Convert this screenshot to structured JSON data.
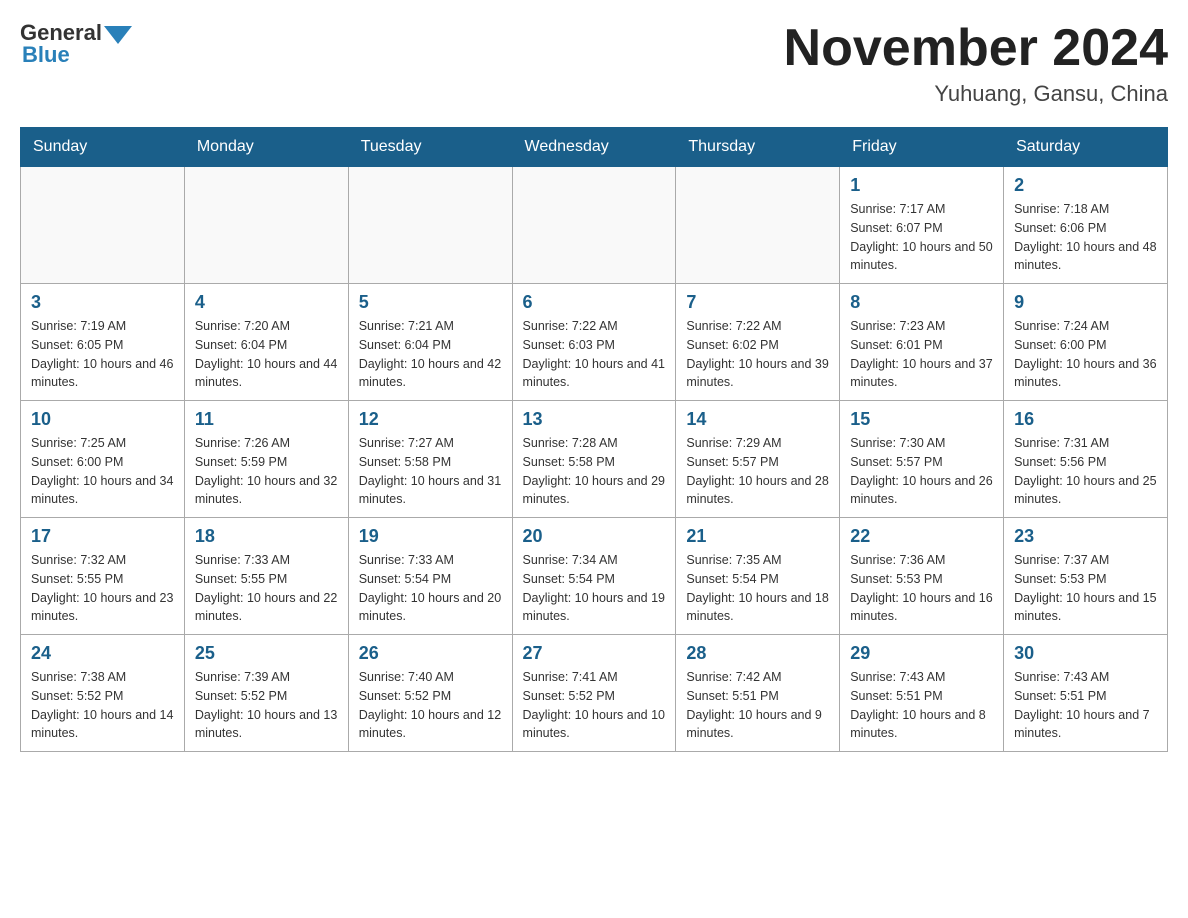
{
  "header": {
    "logo_general": "General",
    "logo_blue": "Blue",
    "month_title": "November 2024",
    "location": "Yuhuang, Gansu, China"
  },
  "weekdays": [
    "Sunday",
    "Monday",
    "Tuesday",
    "Wednesday",
    "Thursday",
    "Friday",
    "Saturday"
  ],
  "weeks": [
    [
      {
        "day": "",
        "info": ""
      },
      {
        "day": "",
        "info": ""
      },
      {
        "day": "",
        "info": ""
      },
      {
        "day": "",
        "info": ""
      },
      {
        "day": "",
        "info": ""
      },
      {
        "day": "1",
        "info": "Sunrise: 7:17 AM\nSunset: 6:07 PM\nDaylight: 10 hours and 50 minutes."
      },
      {
        "day": "2",
        "info": "Sunrise: 7:18 AM\nSunset: 6:06 PM\nDaylight: 10 hours and 48 minutes."
      }
    ],
    [
      {
        "day": "3",
        "info": "Sunrise: 7:19 AM\nSunset: 6:05 PM\nDaylight: 10 hours and 46 minutes."
      },
      {
        "day": "4",
        "info": "Sunrise: 7:20 AM\nSunset: 6:04 PM\nDaylight: 10 hours and 44 minutes."
      },
      {
        "day": "5",
        "info": "Sunrise: 7:21 AM\nSunset: 6:04 PM\nDaylight: 10 hours and 42 minutes."
      },
      {
        "day": "6",
        "info": "Sunrise: 7:22 AM\nSunset: 6:03 PM\nDaylight: 10 hours and 41 minutes."
      },
      {
        "day": "7",
        "info": "Sunrise: 7:22 AM\nSunset: 6:02 PM\nDaylight: 10 hours and 39 minutes."
      },
      {
        "day": "8",
        "info": "Sunrise: 7:23 AM\nSunset: 6:01 PM\nDaylight: 10 hours and 37 minutes."
      },
      {
        "day": "9",
        "info": "Sunrise: 7:24 AM\nSunset: 6:00 PM\nDaylight: 10 hours and 36 minutes."
      }
    ],
    [
      {
        "day": "10",
        "info": "Sunrise: 7:25 AM\nSunset: 6:00 PM\nDaylight: 10 hours and 34 minutes."
      },
      {
        "day": "11",
        "info": "Sunrise: 7:26 AM\nSunset: 5:59 PM\nDaylight: 10 hours and 32 minutes."
      },
      {
        "day": "12",
        "info": "Sunrise: 7:27 AM\nSunset: 5:58 PM\nDaylight: 10 hours and 31 minutes."
      },
      {
        "day": "13",
        "info": "Sunrise: 7:28 AM\nSunset: 5:58 PM\nDaylight: 10 hours and 29 minutes."
      },
      {
        "day": "14",
        "info": "Sunrise: 7:29 AM\nSunset: 5:57 PM\nDaylight: 10 hours and 28 minutes."
      },
      {
        "day": "15",
        "info": "Sunrise: 7:30 AM\nSunset: 5:57 PM\nDaylight: 10 hours and 26 minutes."
      },
      {
        "day": "16",
        "info": "Sunrise: 7:31 AM\nSunset: 5:56 PM\nDaylight: 10 hours and 25 minutes."
      }
    ],
    [
      {
        "day": "17",
        "info": "Sunrise: 7:32 AM\nSunset: 5:55 PM\nDaylight: 10 hours and 23 minutes."
      },
      {
        "day": "18",
        "info": "Sunrise: 7:33 AM\nSunset: 5:55 PM\nDaylight: 10 hours and 22 minutes."
      },
      {
        "day": "19",
        "info": "Sunrise: 7:33 AM\nSunset: 5:54 PM\nDaylight: 10 hours and 20 minutes."
      },
      {
        "day": "20",
        "info": "Sunrise: 7:34 AM\nSunset: 5:54 PM\nDaylight: 10 hours and 19 minutes."
      },
      {
        "day": "21",
        "info": "Sunrise: 7:35 AM\nSunset: 5:54 PM\nDaylight: 10 hours and 18 minutes."
      },
      {
        "day": "22",
        "info": "Sunrise: 7:36 AM\nSunset: 5:53 PM\nDaylight: 10 hours and 16 minutes."
      },
      {
        "day": "23",
        "info": "Sunrise: 7:37 AM\nSunset: 5:53 PM\nDaylight: 10 hours and 15 minutes."
      }
    ],
    [
      {
        "day": "24",
        "info": "Sunrise: 7:38 AM\nSunset: 5:52 PM\nDaylight: 10 hours and 14 minutes."
      },
      {
        "day": "25",
        "info": "Sunrise: 7:39 AM\nSunset: 5:52 PM\nDaylight: 10 hours and 13 minutes."
      },
      {
        "day": "26",
        "info": "Sunrise: 7:40 AM\nSunset: 5:52 PM\nDaylight: 10 hours and 12 minutes."
      },
      {
        "day": "27",
        "info": "Sunrise: 7:41 AM\nSunset: 5:52 PM\nDaylight: 10 hours and 10 minutes."
      },
      {
        "day": "28",
        "info": "Sunrise: 7:42 AM\nSunset: 5:51 PM\nDaylight: 10 hours and 9 minutes."
      },
      {
        "day": "29",
        "info": "Sunrise: 7:43 AM\nSunset: 5:51 PM\nDaylight: 10 hours and 8 minutes."
      },
      {
        "day": "30",
        "info": "Sunrise: 7:43 AM\nSunset: 5:51 PM\nDaylight: 10 hours and 7 minutes."
      }
    ]
  ]
}
